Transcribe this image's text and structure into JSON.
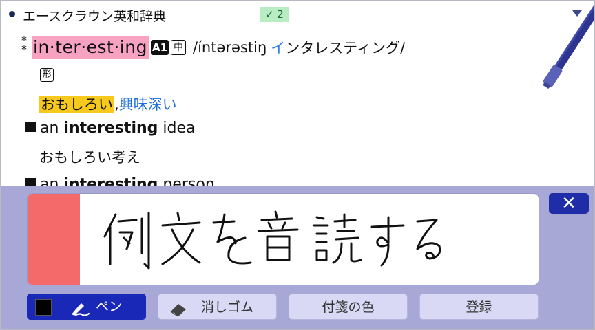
{
  "header": {
    "dictionary_name": "エースクラウン英和辞典",
    "check_count": "2",
    "check_mark": "✓"
  },
  "entry": {
    "asterisk": "*\n*",
    "headword": "in·ter·est·ing",
    "level_badge": "A1",
    "grade_badge": "中",
    "pronunciation": "/íntərəstiŋ",
    "katakana_first": "イ",
    "katakana_rest": "ンタレスティング/",
    "part_of_speech": "形",
    "meaning_primary": "おもしろい",
    "meaning_separator": ",",
    "meaning_secondary": "興味深い",
    "examples": [
      {
        "prefix": "an ",
        "bold": "interesting",
        "suffix": " idea",
        "translation": "おもしろい考え"
      },
      {
        "prefix": "an ",
        "bold": "interesting",
        "suffix": " person"
      }
    ]
  },
  "memo": {
    "handwriting": "例文を音読する",
    "close_label": "✕",
    "pen_label": "ペン",
    "eraser_label": "消しゴム",
    "sticky_color_label": "付箋の色",
    "register_label": "登録"
  },
  "colors": {
    "panel_background": "#a8a8d6",
    "headword_highlight": "#f7a2c0",
    "meaning_highlight": "#f7c91c",
    "link_blue": "#1e6fd8",
    "pen_button": "#1a28b8",
    "sticky_stripe": "#f46a6a",
    "check_badge": "#b8ecc3"
  },
  "icons": {
    "bullet": "bullet-icon",
    "check": "check-icon",
    "dropdown": "chevron-down-icon",
    "pen": "pen-icon",
    "eraser": "eraser-icon",
    "close": "close-icon",
    "stylus": "stylus-icon"
  }
}
